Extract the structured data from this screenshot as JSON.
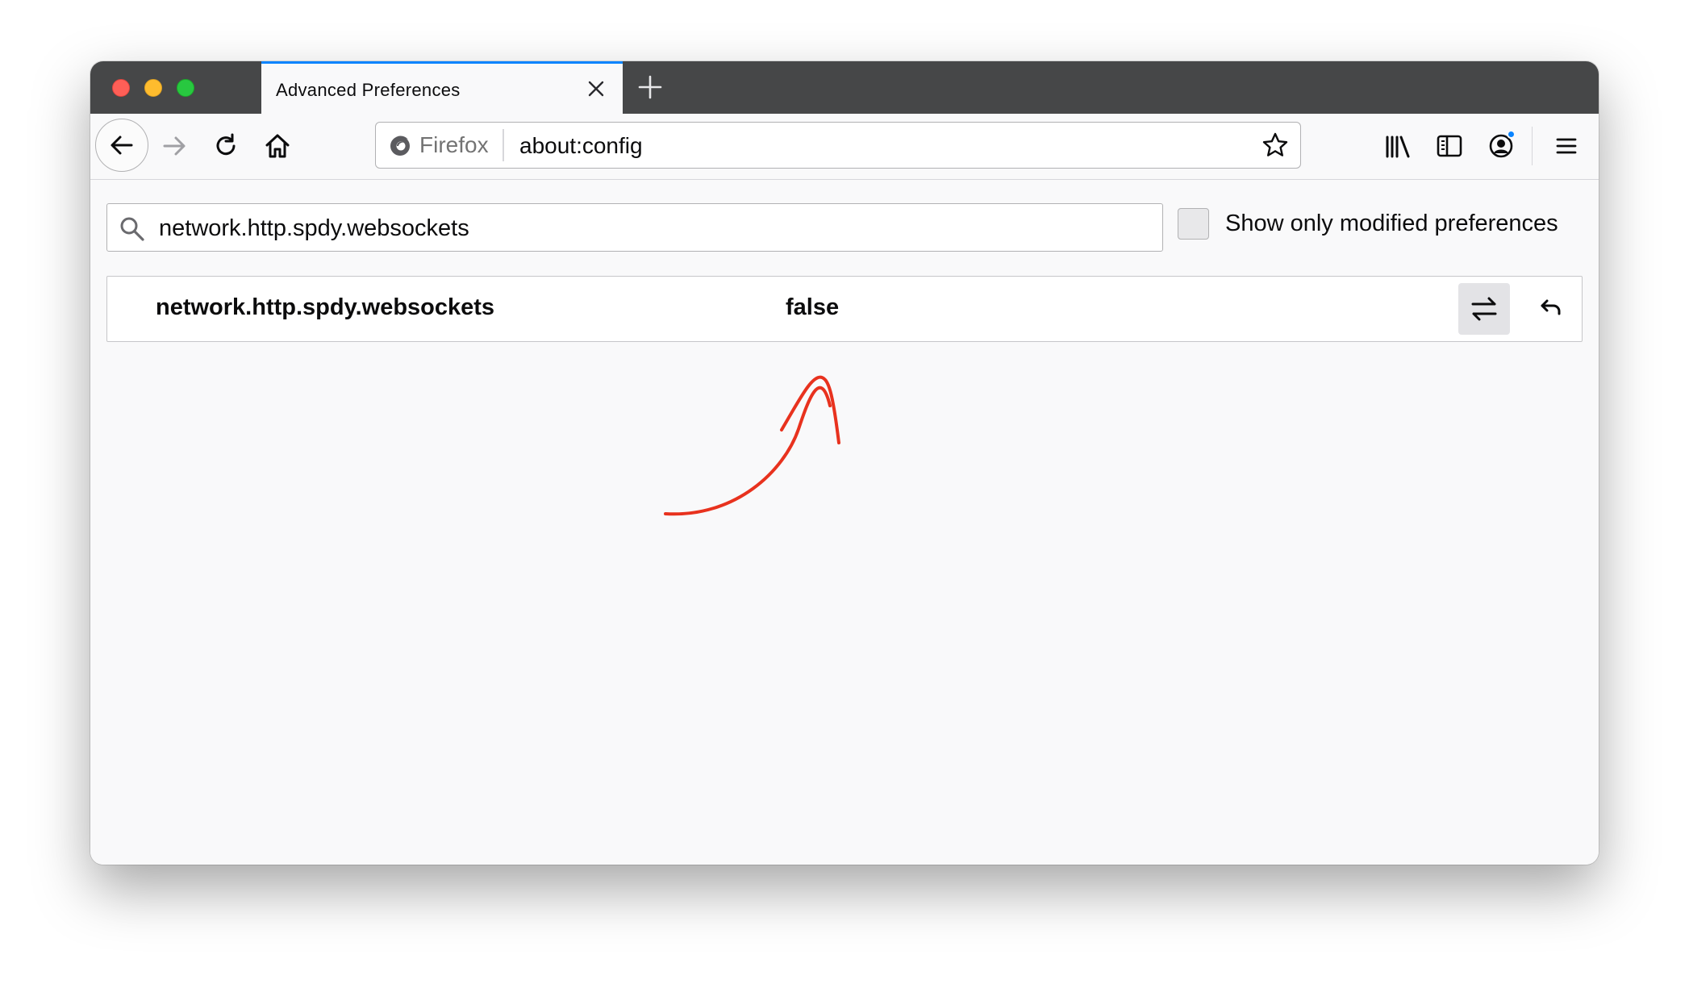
{
  "tab": {
    "title": "Advanced Preferences"
  },
  "urlbar": {
    "identity_label": "Firefox",
    "url": "about:config"
  },
  "search": {
    "value": "network.http.spdy.websockets"
  },
  "filter": {
    "label": "Show only modified preferences",
    "checked": false
  },
  "preferences": [
    {
      "name": "network.http.spdy.websockets",
      "value": "false"
    }
  ],
  "colors": {
    "accent": "#0a84ff",
    "annotation": "#e8321e",
    "titlebar": "#464748"
  },
  "icons": [
    "back-arrow-icon",
    "forward-arrow-icon",
    "reload-icon",
    "home-icon",
    "firefox-logo-icon",
    "star-icon",
    "library-icon",
    "sidebar-icon",
    "account-icon",
    "menu-icon",
    "search-icon",
    "toggle-icon",
    "reset-icon",
    "close-icon",
    "plus-icon"
  ]
}
